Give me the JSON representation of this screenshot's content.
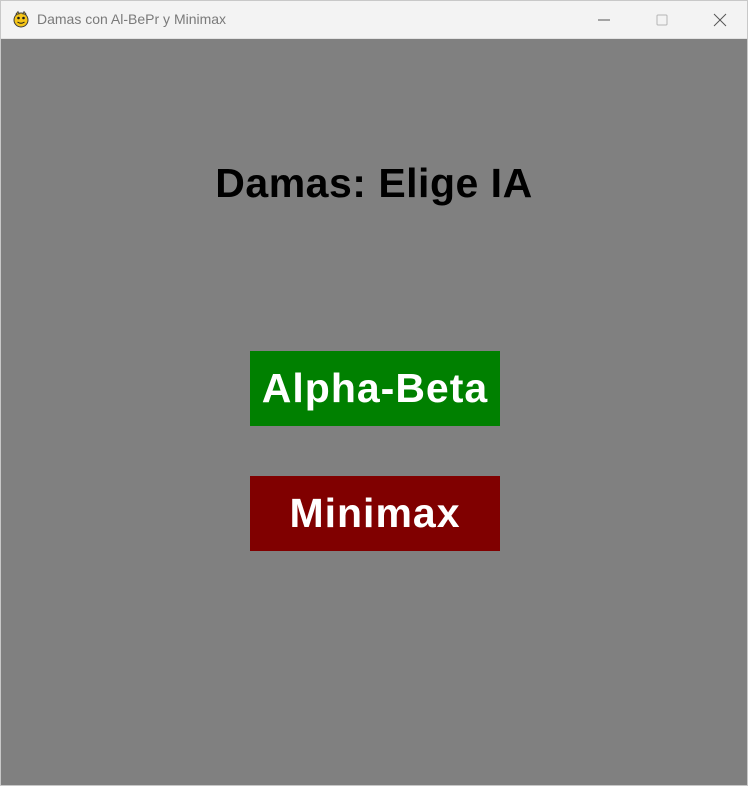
{
  "window": {
    "title": "Damas con Al-BePr y Minimax",
    "icon": "pygame-snake-icon",
    "controls": {
      "minimize_icon": "minimize-icon",
      "maximize_icon": "maximize-icon",
      "close_icon": "close-icon"
    }
  },
  "screen": {
    "background": "#808080",
    "title": "Damas: Elige IA",
    "title_color": "#000000"
  },
  "buttons": {
    "alphabeta": {
      "label": "Alpha-Beta",
      "color": "#008000",
      "text_color": "#FFFFFF"
    },
    "minimax": {
      "label": "Minimax",
      "color": "#800000",
      "text_color": "#FFFFFF"
    }
  }
}
